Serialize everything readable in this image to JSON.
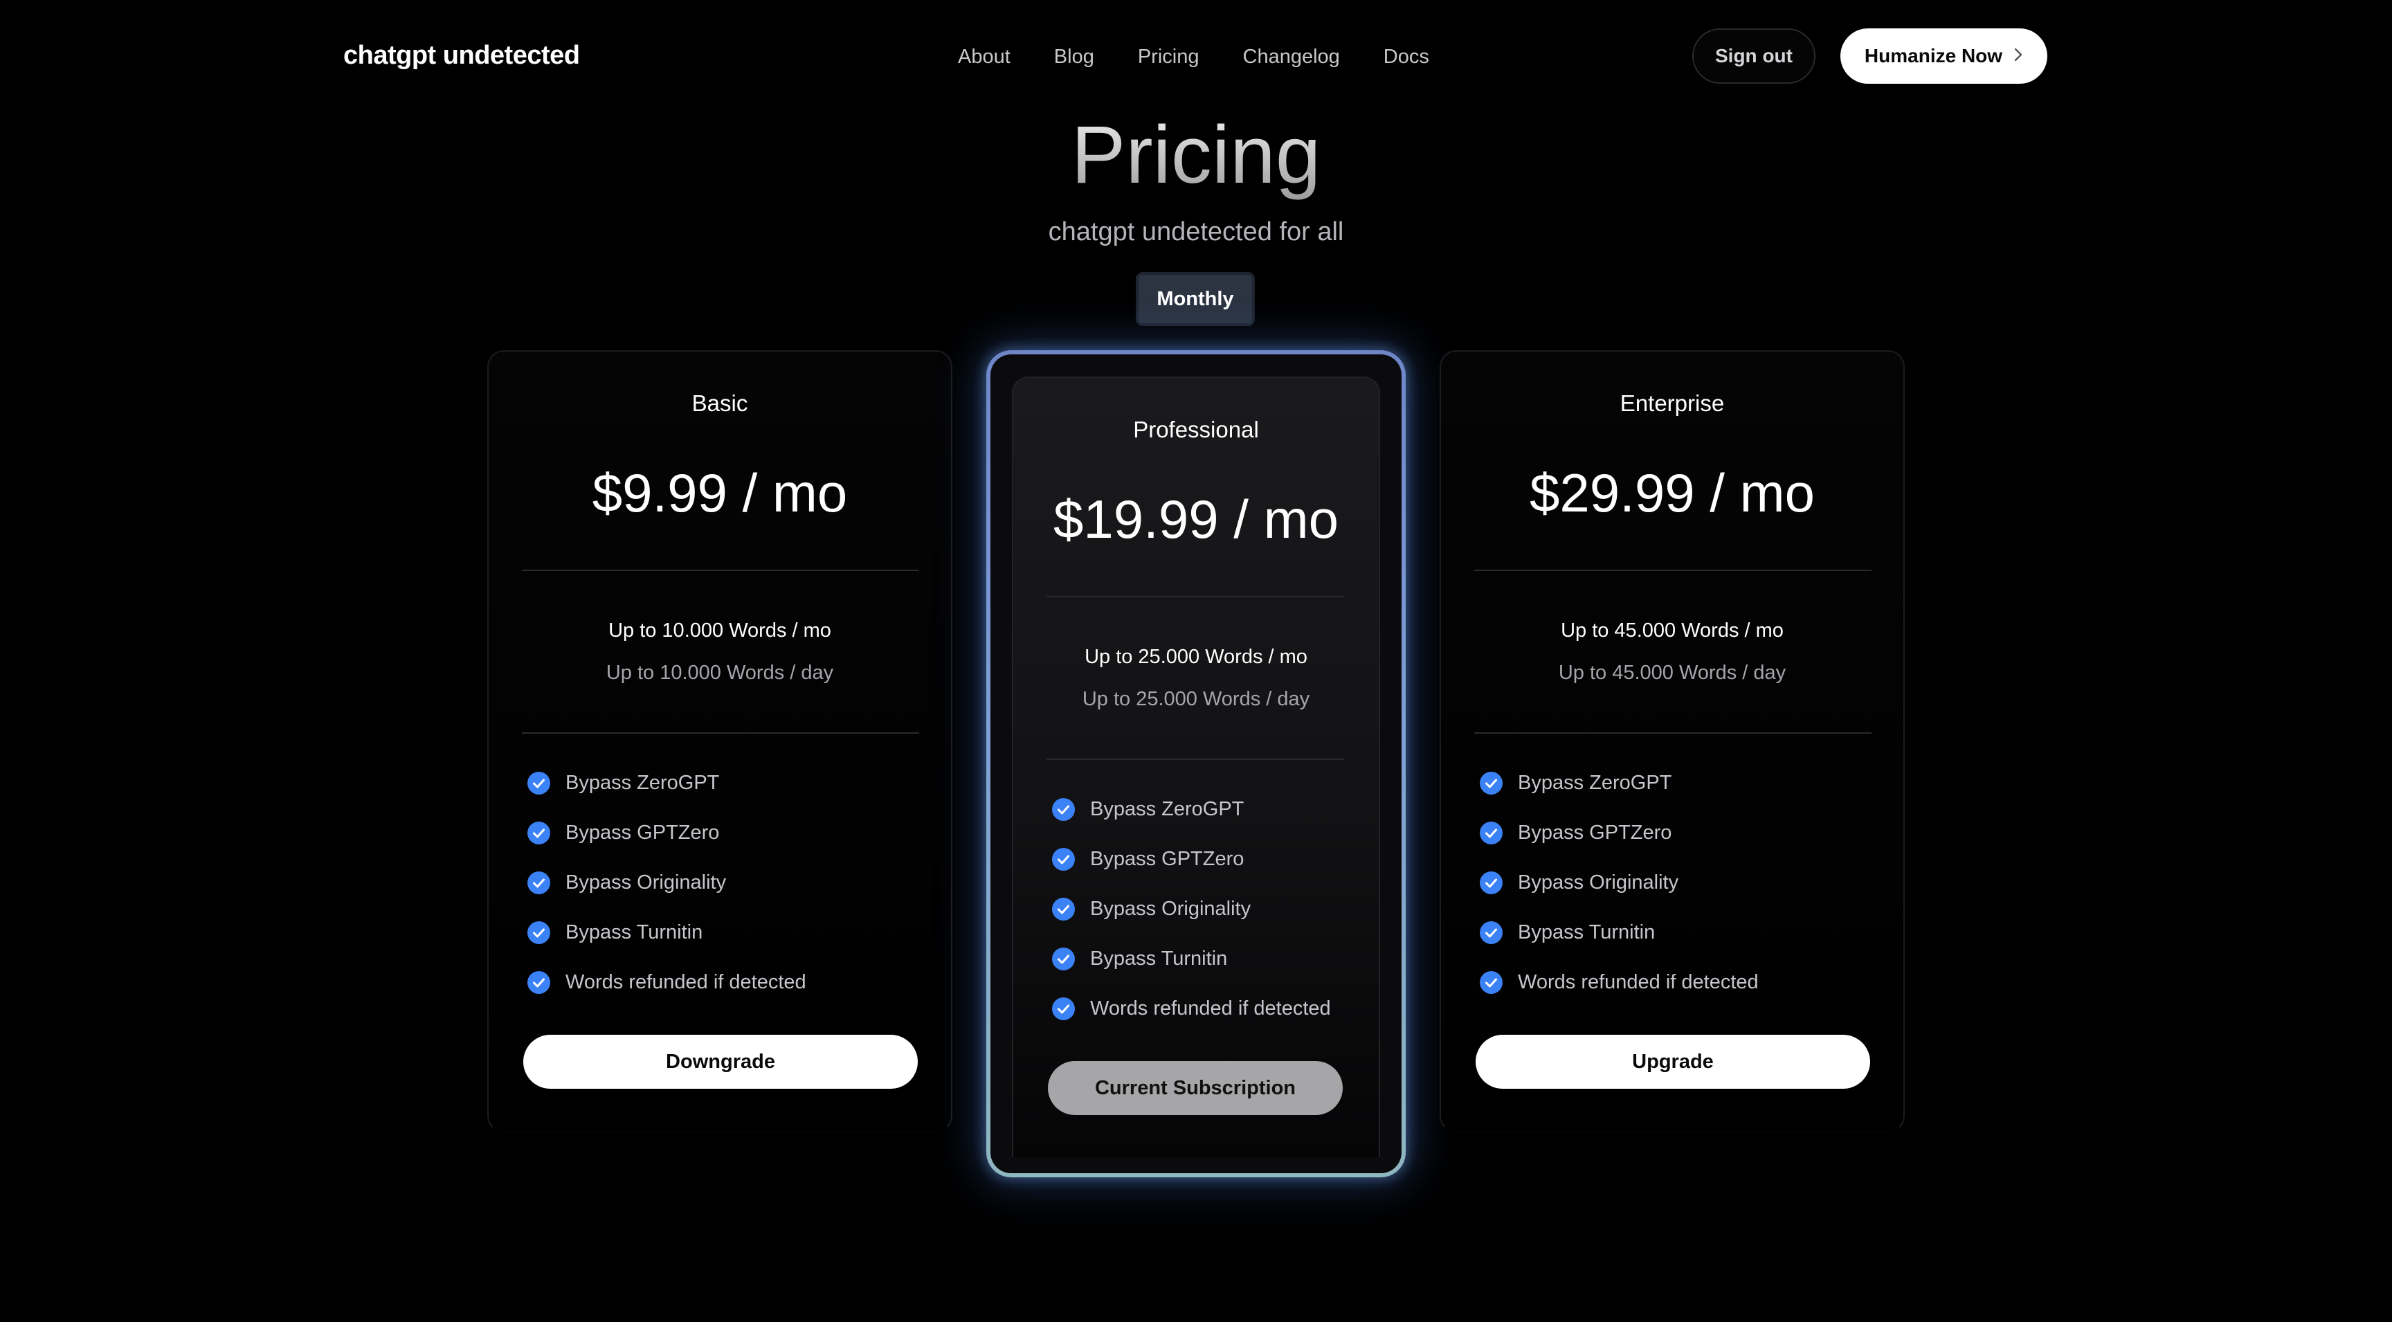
{
  "header": {
    "brand": "chatgpt undetected",
    "nav": [
      "About",
      "Blog",
      "Pricing",
      "Changelog",
      "Docs"
    ],
    "sign_out_label": "Sign out",
    "cta_label": "Humanize Now",
    "cta_icon": "chevron-right-icon"
  },
  "hero": {
    "title": "Pricing",
    "subtitle": "chatgpt undetected for all",
    "billing_toggle": "Monthly"
  },
  "plans": [
    {
      "name": "Basic",
      "price": "$9.99 / mo",
      "quota_month": "Up to 10.000 Words / mo",
      "quota_day": "Up to 10.000 Words / day",
      "features": [
        "Bypass ZeroGPT",
        "Bypass GPTZero",
        "Bypass Originality",
        "Bypass Turnitin",
        "Words refunded if detected"
      ],
      "button": "Downgrade"
    },
    {
      "name": "Professional",
      "price": "$19.99 / mo",
      "quota_month": "Up to 25.000 Words / mo",
      "quota_day": "Up to 25.000 Words / day",
      "features": [
        "Bypass ZeroGPT",
        "Bypass GPTZero",
        "Bypass Originality",
        "Bypass Turnitin",
        "Words refunded if detected"
      ],
      "button": "Current Subscription"
    },
    {
      "name": "Enterprise",
      "price": "$29.99 / mo",
      "quota_month": "Up to 45.000 Words / mo",
      "quota_day": "Up to 45.000 Words / day",
      "features": [
        "Bypass ZeroGPT",
        "Bypass GPTZero",
        "Bypass Originality",
        "Bypass Turnitin",
        "Words refunded if detected"
      ],
      "button": "Upgrade"
    }
  ],
  "colors": {
    "background": "#000000",
    "check_icon": "#3b82f6",
    "highlight_border_top": "#6f86c8",
    "highlight_border_bottom": "#8fb7bf",
    "current_button": "#a6a6a8"
  }
}
